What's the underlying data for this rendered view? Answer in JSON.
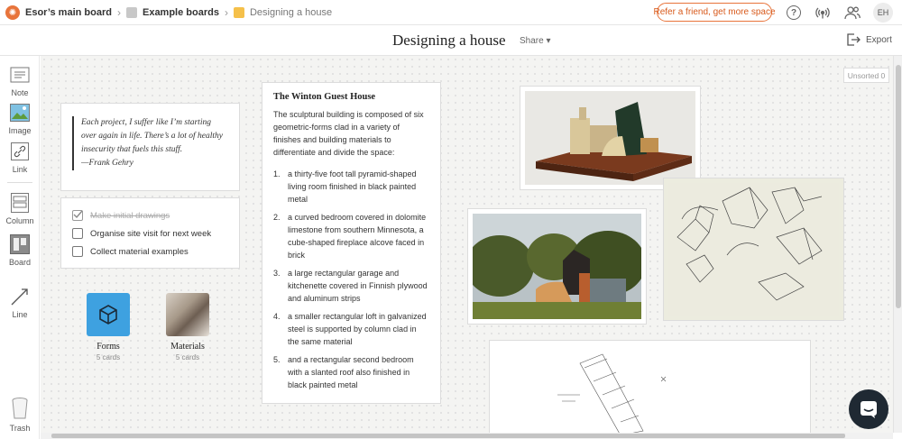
{
  "topbar": {
    "breadcrumbs": [
      {
        "label": "Esor’s main board",
        "color": ""
      },
      {
        "label": "Example boards",
        "color": "#c8c8c8"
      },
      {
        "label": "Designing a house",
        "color": "#f5c04a"
      }
    ],
    "refer_label": "Refer a friend, get more space",
    "help_label": "?",
    "avatar_initials": "EH"
  },
  "titlebar": {
    "title": "Designing a house",
    "share_label": "Share",
    "export_label": "Export"
  },
  "sidebar": {
    "tools": [
      {
        "label": "Note",
        "icon": "note-icon"
      },
      {
        "label": "Image",
        "icon": "image-icon"
      },
      {
        "label": "Link",
        "icon": "link-icon"
      },
      {
        "label": "Column",
        "icon": "column-icon"
      },
      {
        "label": "Board",
        "icon": "board-icon"
      },
      {
        "label": "Line",
        "icon": "line-icon"
      },
      {
        "label": "Trash",
        "icon": "trash-icon"
      }
    ]
  },
  "canvas": {
    "unsorted_label": "Unsorted 0",
    "quote": {
      "lines": [
        "Each project, I suffer like I’m starting",
        "over again in life. There’s a lot of healthy",
        "insecurity that fuels this stuff.",
        "—Frank Gehry"
      ]
    },
    "todo": [
      {
        "label": "Make initial drawings",
        "done": true
      },
      {
        "label": "Organise site visit for next week",
        "done": false
      },
      {
        "label": "Collect material examples",
        "done": false
      }
    ],
    "boards": [
      {
        "name": "Forms",
        "count": "5 cards",
        "color": "#3ea1e0"
      },
      {
        "name": "Materials",
        "count": "5 cards",
        "color": "#8a7b70"
      }
    ],
    "text_card": {
      "title": "The Winton Guest House",
      "intro": "The sculptural building is composed of six geometric-forms clad in a variety of finishes and building materials to differentiate and divide the space:",
      "items": [
        {
          "num": "1.",
          "text": "a thirty-five foot tall pyramid-shaped living room finished in black painted metal"
        },
        {
          "num": "2.",
          "text": "a curved bedroom covered in dolomite limestone from southern Minnesota, a cube-shaped fireplace alcove faced in brick"
        },
        {
          "num": "3.",
          "text": "a large rectangular garage and kitchenette covered in Finnish plywood and aluminum strips"
        },
        {
          "num": "4.",
          "text": "a smaller rectangular loft in galvanized steel is supported by column clad in the same material"
        },
        {
          "num": "5.",
          "text": "and a rectangular second bedroom with a slanted roof also finished in black painted metal"
        }
      ]
    }
  },
  "colors": {
    "accent": "#e8743b",
    "chat_bg": "#1f2933"
  }
}
